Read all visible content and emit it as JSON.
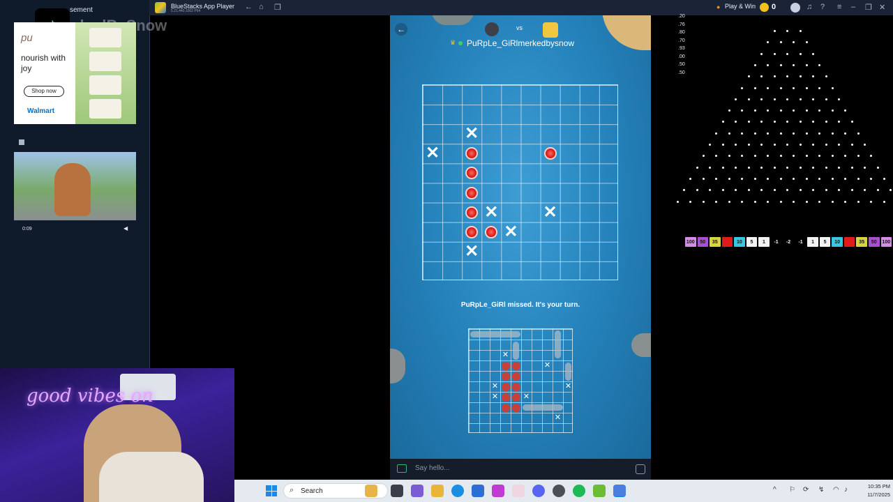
{
  "stream_overlay": {
    "watermark": "rkedBySnow",
    "ad_label": "sement",
    "ad": {
      "brand_corner": "pu",
      "heading": "nourish with joy",
      "cta": "Shop now",
      "retailer": "Walmart"
    },
    "video": {
      "time": "0:09"
    }
  },
  "webcam": {
    "neon_sign": "good vibes on"
  },
  "bluestacks": {
    "title": "BlueStacks App Player",
    "version": "5.21.440.1002  P64",
    "play_win": "Play & Win",
    "coin_count": "0"
  },
  "game": {
    "vs_label": "vs",
    "opponent_name": "PuRpLe_GiRl",
    "player_name": "merkedbysnow",
    "turn_message": "PuRpLe_GiRl missed. It's your turn.",
    "chat_placeholder": "Say hello...",
    "target_grid": {
      "size": 10,
      "misses": [
        [
          2,
          2
        ],
        [
          3,
          0
        ],
        [
          6,
          3
        ],
        [
          6,
          6
        ],
        [
          7,
          4
        ],
        [
          8,
          2
        ]
      ],
      "hits": [
        [
          3,
          2
        ],
        [
          3,
          6
        ],
        [
          4,
          2
        ],
        [
          5,
          2
        ],
        [
          6,
          2
        ],
        [
          7,
          2
        ],
        [
          7,
          3
        ]
      ]
    },
    "own_grid": {
      "size": 10,
      "misses": [
        [
          2,
          3
        ],
        [
          3,
          7
        ],
        [
          5,
          2
        ],
        [
          5,
          9
        ],
        [
          6,
          5
        ],
        [
          6,
          2
        ],
        [
          8,
          8
        ]
      ],
      "hits": [
        [
          3,
          3
        ],
        [
          3,
          4
        ],
        [
          4,
          3
        ],
        [
          4,
          4
        ],
        [
          5,
          3
        ],
        [
          5,
          4
        ],
        [
          6,
          3
        ],
        [
          6,
          4
        ],
        [
          7,
          3
        ],
        [
          7,
          4
        ]
      ]
    }
  },
  "plinko": {
    "multipliers_side": [
      ".20",
      ".76",
      ".80",
      ".70",
      ".93",
      ".00",
      ".50",
      ".50"
    ],
    "buckets": [
      {
        "label": "100",
        "color": "#d68be6"
      },
      {
        "label": "50",
        "color": "#a94fcf"
      },
      {
        "label": "35",
        "color": "#d8d63a"
      },
      {
        "label": "",
        "color": "#e01b1b"
      },
      {
        "label": "10",
        "color": "#36c8e0"
      },
      {
        "label": "5",
        "color": "#f2f2f2"
      },
      {
        "label": "1",
        "color": "#f2f2f2"
      },
      {
        "label": "-1",
        "color": "#000000"
      },
      {
        "label": "-2",
        "color": "#000000"
      },
      {
        "label": "-1",
        "color": "#000000"
      },
      {
        "label": "1",
        "color": "#f2f2f2"
      },
      {
        "label": "5",
        "color": "#f2f2f2"
      },
      {
        "label": "10",
        "color": "#36c8e0"
      },
      {
        "label": "",
        "color": "#e01b1b"
      },
      {
        "label": "35",
        "color": "#d8d63a"
      },
      {
        "label": "50",
        "color": "#a94fcf"
      },
      {
        "label": "100",
        "color": "#d68be6"
      }
    ]
  },
  "taskbar": {
    "search_label": "Search",
    "time": "10:35 PM",
    "date": "11/7/2025"
  }
}
